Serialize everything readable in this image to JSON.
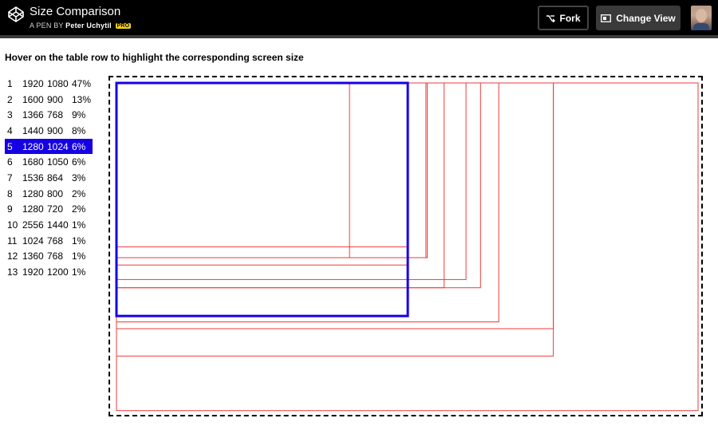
{
  "header": {
    "title": "Size Comparison",
    "byline_prefix": "A PEN BY",
    "author": "Peter Uchytil",
    "badge": "PRO",
    "fork_label": "Fork",
    "change_view_label": "Change View"
  },
  "instruction": "Hover on the table row to highlight the corresponding screen size",
  "resolutions": [
    {
      "rank": "1",
      "width": "1920",
      "height": "1080",
      "share": "47%"
    },
    {
      "rank": "2",
      "width": "1600",
      "height": "900",
      "share": "13%"
    },
    {
      "rank": "3",
      "width": "1366",
      "height": "768",
      "share": "9%"
    },
    {
      "rank": "4",
      "width": "1440",
      "height": "900",
      "share": "8%"
    },
    {
      "rank": "5",
      "width": "1280",
      "height": "1024",
      "share": "6%"
    },
    {
      "rank": "6",
      "width": "1680",
      "height": "1050",
      "share": "6%"
    },
    {
      "rank": "7",
      "width": "1536",
      "height": "864",
      "share": "3%"
    },
    {
      "rank": "8",
      "width": "1280",
      "height": "800",
      "share": "2%"
    },
    {
      "rank": "9",
      "width": "1280",
      "height": "720",
      "share": "2%"
    },
    {
      "rank": "10",
      "width": "2556",
      "height": "1440",
      "share": "1%"
    },
    {
      "rank": "11",
      "width": "1024",
      "height": "768",
      "share": "1%"
    },
    {
      "rank": "12",
      "width": "1360",
      "height": "768",
      "share": "1%"
    },
    {
      "rank": "13",
      "width": "1920",
      "height": "1200",
      "share": "1%"
    }
  ],
  "highlighted_rank": "5",
  "colors": {
    "highlight": "#1500e3",
    "outline": "#ee3b3b"
  },
  "icons": {
    "logo": "codepen-logo-icon",
    "fork": "fork-icon",
    "change_view": "change-view-icon"
  }
}
